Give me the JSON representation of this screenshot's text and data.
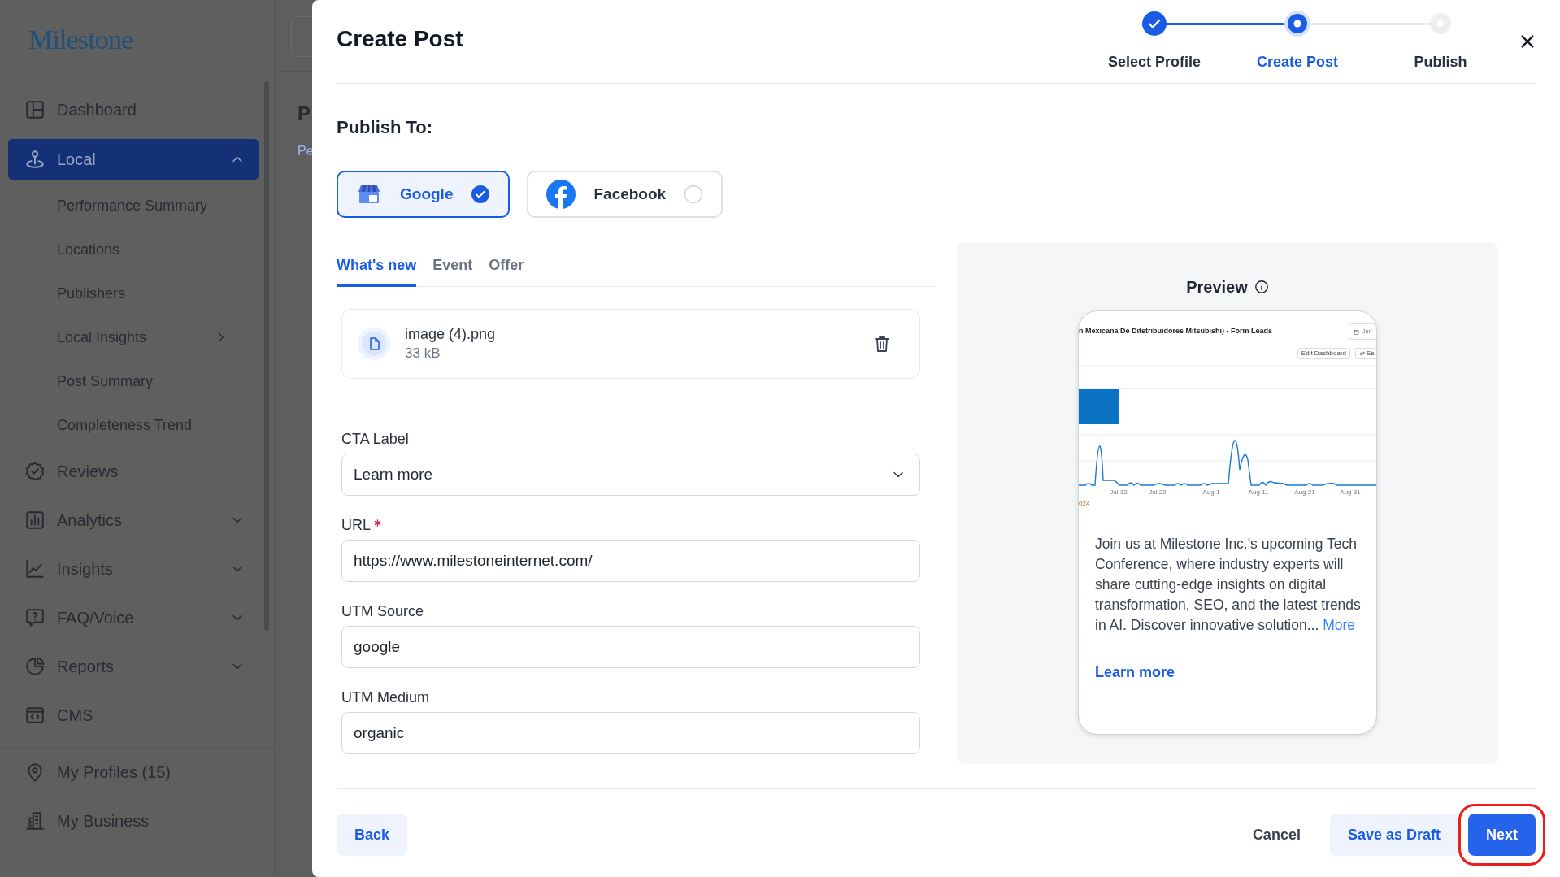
{
  "sidebar": {
    "logo": "Milestone",
    "items": [
      {
        "label": "Dashboard",
        "selected": false
      },
      {
        "label": "Local",
        "selected": true,
        "expanded": true,
        "children": [
          {
            "label": "Performance Summary",
            "has_submenu": false
          },
          {
            "label": "Locations",
            "has_submenu": false
          },
          {
            "label": "Publishers",
            "has_submenu": false
          },
          {
            "label": "Local Insights",
            "has_submenu": true
          },
          {
            "label": "Post Summary",
            "has_submenu": false
          },
          {
            "label": "Completeness Trend",
            "has_submenu": false
          }
        ]
      },
      {
        "label": "Reviews",
        "selected": false
      },
      {
        "label": "Analytics",
        "selected": false,
        "expanded": false
      },
      {
        "label": "Insights",
        "selected": false,
        "expanded": false
      },
      {
        "label": "FAQ/Voice",
        "selected": false,
        "expanded": false
      },
      {
        "label": "Reports",
        "selected": false,
        "expanded": false
      },
      {
        "label": "CMS",
        "selected": false
      }
    ],
    "footer_items": [
      {
        "label": "My Profiles (15)"
      },
      {
        "label": "My Business"
      }
    ]
  },
  "background_page": {
    "title": "P",
    "link": "Pe"
  },
  "modal": {
    "title": "Create Post",
    "steps": [
      {
        "label": "Select Profile",
        "completed": true,
        "selected": false
      },
      {
        "label": "Create Post",
        "completed": false,
        "selected": true
      },
      {
        "label": "Publish",
        "completed": false,
        "selected": false
      }
    ],
    "publish_to": {
      "label": "Publish To:",
      "platforms": [
        {
          "name": "Google",
          "selected": true
        },
        {
          "name": "Facebook",
          "selected": false
        }
      ]
    },
    "tabs": [
      {
        "label": "What's new",
        "selected": true
      },
      {
        "label": "Event",
        "selected": false
      },
      {
        "label": "Offer",
        "selected": false
      }
    ],
    "attachment": {
      "filename": "image (4).png",
      "size": "33 kB"
    },
    "fields": [
      {
        "kind": "select",
        "label": "CTA Label",
        "required": false,
        "value": "Learn more"
      },
      {
        "kind": "text",
        "label": "URL",
        "required": true,
        "value": "https://www.milestoneinternet.com/"
      },
      {
        "kind": "text",
        "label": "UTM Source",
        "required": false,
        "value": "google"
      },
      {
        "kind": "text",
        "label": "UTM Medium",
        "required": false,
        "value": "organic"
      }
    ],
    "preview": {
      "title": "Preview",
      "screenshot": {
        "title": "n Mexicana De Ditstribuidores Mitsubishi) - Form Leads",
        "date_button": "Jun",
        "edit_button": "Edit Dashboard",
        "settings_button": "Se",
        "axis_labels": [
          "Jul 12",
          "Jul 22",
          "Aug 1",
          "Aug 11",
          "Aug 21",
          "Aug 31"
        ],
        "footnote": "024"
      },
      "body": "Join us at Milestone Inc.'s upcoming Tech Conference, where industry experts will share cutting-edge insights on digital transformation, SEO, and the latest trends in AI. Discover innovative solution...",
      "more": "More",
      "cta": "Learn more"
    },
    "buttons": [
      {
        "label": "Back",
        "kind": "secondary",
        "highlighted": false
      },
      {
        "label": "Cancel",
        "kind": "plain",
        "highlighted": false
      },
      {
        "label": "Save as Draft",
        "kind": "secondary",
        "highlighted": false
      },
      {
        "label": "Next",
        "kind": "primary",
        "highlighted": true
      }
    ]
  }
}
